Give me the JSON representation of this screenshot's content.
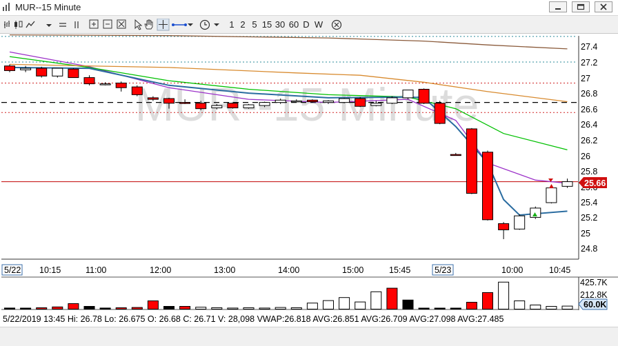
{
  "window": {
    "title": "MUR--15 Minute"
  },
  "toolbar": {
    "intervals": [
      "1",
      "2",
      "5",
      "15",
      "30",
      "60",
      "D",
      "W"
    ]
  },
  "watermark": "MUR--15 Minute",
  "price_axis": {
    "ticks": [
      "27.4",
      "27.2",
      "27",
      "26.8",
      "26.6",
      "26.4",
      "26.2",
      "26",
      "25.8",
      "25.6",
      "25.4",
      "25.2",
      "25",
      "24.8"
    ],
    "last_price_label": "25.66"
  },
  "volume_axis": {
    "ticks": [
      "425.7K",
      "212.8K"
    ],
    "last_volume_label": "60.0K"
  },
  "time_axis": {
    "labels": [
      {
        "text": "5/22",
        "boxed": true
      },
      {
        "text": "10:15"
      },
      {
        "text": "11:00"
      },
      {
        "text": "12:00"
      },
      {
        "text": "13:00"
      },
      {
        "text": "14:00"
      },
      {
        "text": "15:00"
      },
      {
        "text": "15:45"
      },
      {
        "text": "5/23",
        "boxed": true
      },
      {
        "text": "10:00"
      },
      {
        "text": "10:45"
      }
    ]
  },
  "status": {
    "text": "5/22/2019 13:45  Hi: 26.78  Lo: 26.675  O: 26.68  C: 26.71  V: 28,098  VWAP:26.818  AVG:26.851  AVG:26.709  AVG:27.098  AVG:27.485"
  },
  "chart_data": {
    "type": "candlestick",
    "title": "MUR--15 Minute",
    "y_range": [
      24.7,
      27.55
    ],
    "candles": [
      {
        "o": 27.15,
        "h": 27.17,
        "l": 27.07,
        "c": 27.09,
        "col": "red"
      },
      {
        "o": 27.12,
        "h": 27.15,
        "l": 27.07,
        "c": 27.1,
        "col": "white"
      },
      {
        "o": 27.12,
        "h": 27.14,
        "l": 27.0,
        "c": 27.02,
        "col": "red"
      },
      {
        "o": 27.02,
        "h": 27.12,
        "l": 27.0,
        "c": 27.12,
        "col": "white"
      },
      {
        "o": 27.11,
        "h": 27.12,
        "l": 27.0,
        "c": 27.0,
        "col": "red"
      },
      {
        "o": 27.0,
        "h": 27.03,
        "l": 26.9,
        "c": 26.92,
        "col": "red"
      },
      {
        "o": 26.92,
        "h": 26.94,
        "l": 26.9,
        "c": 26.92,
        "col": "white"
      },
      {
        "o": 26.93,
        "h": 26.95,
        "l": 26.82,
        "c": 26.87,
        "col": "red"
      },
      {
        "o": 26.88,
        "h": 26.9,
        "l": 26.76,
        "c": 26.78,
        "col": "red"
      },
      {
        "o": 26.74,
        "h": 26.76,
        "l": 26.7,
        "c": 26.72,
        "col": "red"
      },
      {
        "o": 26.73,
        "h": 26.74,
        "l": 26.6,
        "c": 26.67,
        "col": "red"
      },
      {
        "o": 26.68,
        "h": 26.72,
        "l": 26.66,
        "c": 26.68,
        "col": "red"
      },
      {
        "o": 26.67,
        "h": 26.7,
        "l": 26.58,
        "c": 26.6,
        "col": "red"
      },
      {
        "o": 26.61,
        "h": 26.66,
        "l": 26.59,
        "c": 26.64,
        "col": "white"
      },
      {
        "o": 26.67,
        "h": 26.68,
        "l": 26.6,
        "c": 26.61,
        "col": "red"
      },
      {
        "o": 26.61,
        "h": 26.66,
        "l": 26.6,
        "c": 26.65,
        "col": "white"
      },
      {
        "o": 26.64,
        "h": 26.69,
        "l": 26.62,
        "c": 26.68,
        "col": "white"
      },
      {
        "o": 26.68,
        "h": 26.73,
        "l": 26.66,
        "c": 26.71,
        "col": "white"
      },
      {
        "o": 26.7,
        "h": 26.72,
        "l": 26.68,
        "c": 26.7,
        "col": "white"
      },
      {
        "o": 26.71,
        "h": 26.72,
        "l": 26.68,
        "c": 26.69,
        "col": "red"
      },
      {
        "o": 26.68,
        "h": 26.71,
        "l": 26.66,
        "c": 26.7,
        "col": "white"
      },
      {
        "o": 26.68,
        "h": 26.74,
        "l": 26.67,
        "c": 26.73,
        "col": "white"
      },
      {
        "o": 26.73,
        "h": 26.75,
        "l": 26.62,
        "c": 26.63,
        "col": "red"
      },
      {
        "o": 26.64,
        "h": 26.7,
        "l": 26.63,
        "c": 26.67,
        "col": "white"
      },
      {
        "o": 26.67,
        "h": 26.76,
        "l": 26.66,
        "c": 26.74,
        "col": "white"
      },
      {
        "o": 26.74,
        "h": 26.84,
        "l": 26.72,
        "c": 26.84,
        "col": "white"
      },
      {
        "o": 26.85,
        "h": 26.86,
        "l": 26.66,
        "c": 26.67,
        "col": "red"
      },
      {
        "o": 26.67,
        "h": 26.7,
        "l": 26.4,
        "c": 26.41,
        "col": "red"
      },
      {
        "o": 26.01,
        "h": 26.03,
        "l": 26.0,
        "c": 26.01,
        "col": "red"
      },
      {
        "o": 26.34,
        "h": 26.35,
        "l": 25.5,
        "c": 25.51,
        "col": "red"
      },
      {
        "o": 26.04,
        "h": 26.06,
        "l": 25.16,
        "c": 25.17,
        "col": "red"
      },
      {
        "o": 25.12,
        "h": 25.14,
        "l": 24.92,
        "c": 25.04,
        "col": "red"
      },
      {
        "o": 25.05,
        "h": 25.24,
        "l": 25.04,
        "c": 25.22,
        "col": "white"
      },
      {
        "o": 25.2,
        "h": 25.34,
        "l": 25.18,
        "c": 25.32,
        "col": "white"
      },
      {
        "o": 25.39,
        "h": 25.62,
        "l": 25.38,
        "c": 25.58,
        "col": "white"
      },
      {
        "o": 25.6,
        "h": 25.7,
        "l": 25.58,
        "c": 25.66,
        "col": "white"
      }
    ],
    "volumes": [
      {
        "v": 8,
        "col": "black"
      },
      {
        "v": 6,
        "col": "black"
      },
      {
        "v": 10,
        "col": "red"
      },
      {
        "v": 16,
        "col": "red"
      },
      {
        "v": 40,
        "col": "red"
      },
      {
        "v": 20,
        "col": "black"
      },
      {
        "v": 8,
        "col": "black"
      },
      {
        "v": 10,
        "col": "red"
      },
      {
        "v": 12,
        "col": "red"
      },
      {
        "v": 60,
        "col": "red"
      },
      {
        "v": 20,
        "col": "black"
      },
      {
        "v": 20,
        "col": "red"
      },
      {
        "v": 14,
        "col": "white"
      },
      {
        "v": 10,
        "col": "white"
      },
      {
        "v": 8,
        "col": "white"
      },
      {
        "v": 10,
        "col": "white"
      },
      {
        "v": 8,
        "col": "white"
      },
      {
        "v": 12,
        "col": "white"
      },
      {
        "v": 10,
        "col": "white"
      },
      {
        "v": 44,
        "col": "white"
      },
      {
        "v": 62,
        "col": "white"
      },
      {
        "v": 84,
        "col": "white"
      },
      {
        "v": 52,
        "col": "white"
      },
      {
        "v": 126,
        "col": "white"
      },
      {
        "v": 152,
        "col": "red"
      },
      {
        "v": 66,
        "col": "black"
      },
      {
        "v": 4,
        "col": "black"
      },
      {
        "v": 4,
        "col": "black"
      },
      {
        "v": 4,
        "col": "black"
      },
      {
        "v": 50,
        "col": "red"
      },
      {
        "v": 120,
        "col": "red"
      },
      {
        "v": 196,
        "col": "white"
      },
      {
        "v": 60,
        "col": "white"
      },
      {
        "v": 30,
        "col": "white"
      },
      {
        "v": 20,
        "col": "white"
      },
      {
        "v": 22,
        "col": "white"
      }
    ],
    "reference_lines": {
      "dashed_black": 26.68,
      "red_dotted": [
        26.93,
        26.55
      ],
      "teal_dotted": [
        27.53,
        27.2
      ],
      "last_price_red": 25.66
    },
    "moving_averages": [
      {
        "color": "#9b30c8",
        "points": [
          [
            0,
            27.33
          ],
          [
            5,
            27.14
          ],
          [
            10,
            26.87
          ],
          [
            15,
            26.72
          ],
          [
            20,
            26.68
          ],
          [
            25,
            26.72
          ],
          [
            28,
            26.45
          ],
          [
            30,
            25.9
          ],
          [
            33,
            25.68
          ],
          [
            35,
            25.64
          ]
        ]
      },
      {
        "color": "#00c000",
        "points": [
          [
            0,
            27.27
          ],
          [
            5,
            27.13
          ],
          [
            10,
            26.96
          ],
          [
            15,
            26.85
          ],
          [
            20,
            26.78
          ],
          [
            25,
            26.75
          ],
          [
            28,
            26.6
          ],
          [
            31,
            26.28
          ],
          [
            35,
            26.07
          ]
        ]
      },
      {
        "color": "#d88a2e",
        "points": [
          [
            0,
            27.17
          ],
          [
            10,
            27.13
          ],
          [
            18,
            27.06
          ],
          [
            22,
            27.03
          ],
          [
            26,
            26.94
          ],
          [
            30,
            26.82
          ],
          [
            35,
            26.69
          ]
        ]
      },
      {
        "color": "#8a5a3a",
        "points": [
          [
            0,
            27.55
          ],
          [
            10,
            27.54
          ],
          [
            20,
            27.51
          ],
          [
            26,
            27.47
          ],
          [
            30,
            27.42
          ],
          [
            35,
            27.37
          ]
        ]
      },
      {
        "color": "#2a6ca0",
        "points": [
          [
            0,
            27.13
          ],
          [
            5,
            27.12
          ],
          [
            10,
            26.9
          ],
          [
            15,
            26.8
          ],
          [
            20,
            26.74
          ],
          [
            25,
            26.75
          ],
          [
            26,
            26.74
          ],
          [
            28,
            26.37
          ],
          [
            30,
            25.9
          ],
          [
            31,
            25.43
          ],
          [
            32,
            25.23
          ],
          [
            35,
            25.28
          ]
        ]
      }
    ]
  }
}
